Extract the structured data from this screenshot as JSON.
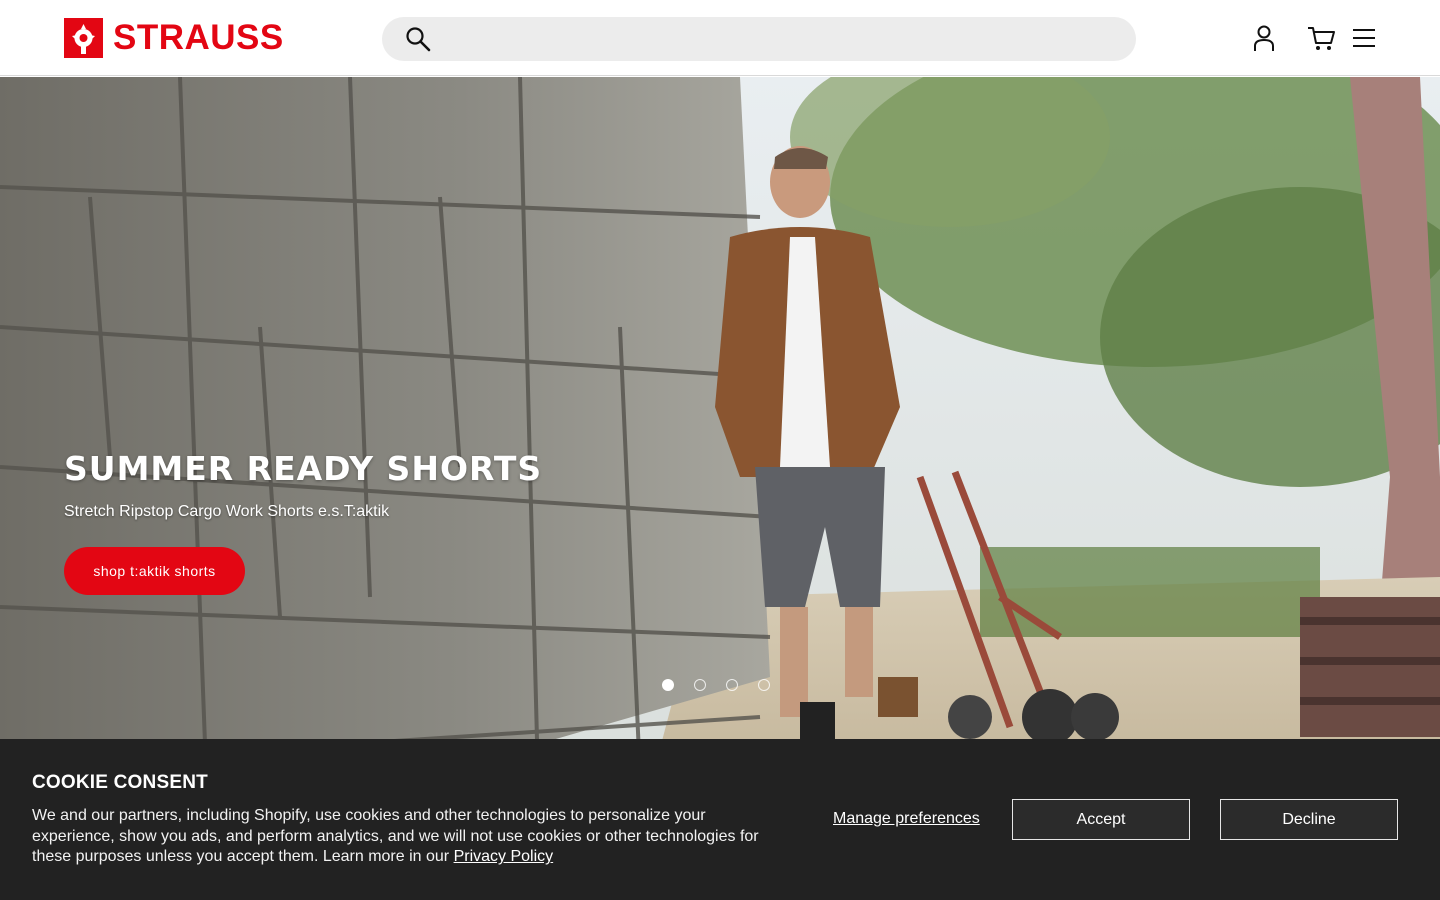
{
  "brand": {
    "name": "STRAUSS",
    "color": "#e30613"
  },
  "header": {
    "search_placeholder": "",
    "icons": [
      "search-icon",
      "account-icon",
      "cart-icon",
      "menu-icon"
    ]
  },
  "hero": {
    "title": "SUMMER READY SHORTS",
    "subtitle": "Stretch Ripstop Cargo Work Shorts e.s.T:aktik",
    "cta_label": "shop t:aktik shorts",
    "slide_count": 4,
    "active_slide": 1
  },
  "cookie": {
    "title": "COOKIE CONSENT",
    "text": "We and our partners, including Shopify, use cookies and other technologies to personalize your experience, show you ads, and perform analytics, and we will not use cookies or other technologies for these purposes unless you accept them. Learn more in our ",
    "privacy_link": "Privacy Policy",
    "manage_label": "Manage preferences",
    "accept_label": "Accept",
    "decline_label": "Decline",
    "background": "#222222"
  }
}
